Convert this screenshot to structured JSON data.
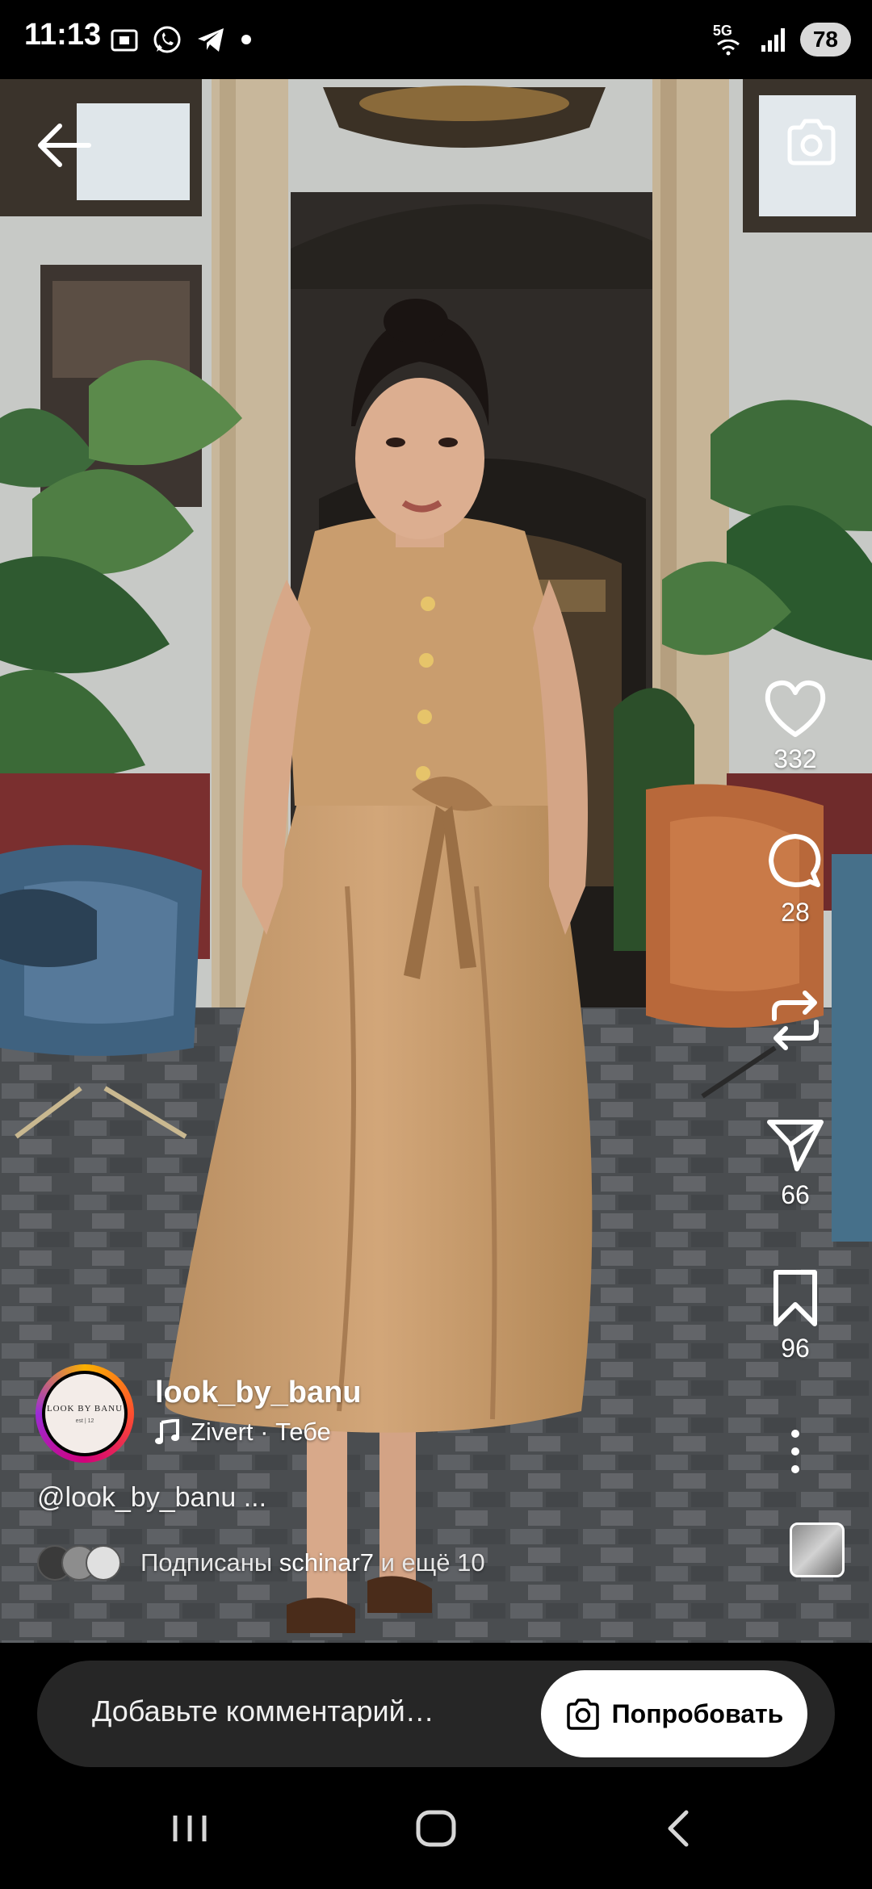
{
  "status_bar": {
    "time": "11:13",
    "network": "5G",
    "battery": "78",
    "icons": [
      "screenshot-icon",
      "whatsapp-icon",
      "telegram-icon",
      "notification-dot-icon",
      "wifi-icon",
      "signal-icon"
    ]
  },
  "top_controls": {
    "back_icon": "arrow-left-icon",
    "camera_icon": "camera-icon"
  },
  "actions": {
    "like_count": "332",
    "comment_count": "28",
    "repost_icon": "repost-icon",
    "share_count": "66",
    "save_count": "96",
    "more_icon": "more-vertical-icon"
  },
  "post": {
    "username": "look_by_banu",
    "avatar_brand": "LOOK BY BANU",
    "avatar_sub": "est | 12",
    "music_artist": "Zivert",
    "music_separator": " · ",
    "music_track": "Тебе",
    "caption": "@look_by_banu ...",
    "followed_prefix": "Подписаны ",
    "followed_user": "schinar7",
    "followed_suffix": " и ещё 10"
  },
  "comment_bar": {
    "placeholder": "Добавьте комментарий…",
    "try_label": "Попробовать"
  },
  "colors": {
    "background": "#000000",
    "comment_pill": "#262626",
    "dress": "#c49a6c",
    "ring_start": "#f9b000",
    "ring_end": "#9b2bd6"
  }
}
